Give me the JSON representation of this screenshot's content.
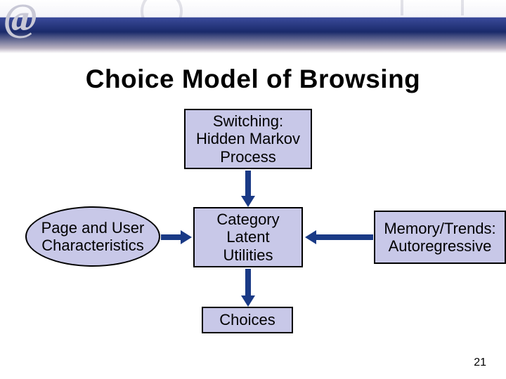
{
  "title": "Choice Model of Browsing",
  "nodes": {
    "switching": "Switching:\nHidden Markov\nProcess",
    "page_user": "Page and User\nCharacteristics",
    "category": "Category\nLatent\nUtilities",
    "memory": "Memory/Trends:\nAutoregressive",
    "choices": "Choices"
  },
  "colors": {
    "box_fill": "#c8c8e8",
    "arrow": "#1a3a86",
    "banner_dark": "#1a2a6a"
  },
  "page_number": "21"
}
